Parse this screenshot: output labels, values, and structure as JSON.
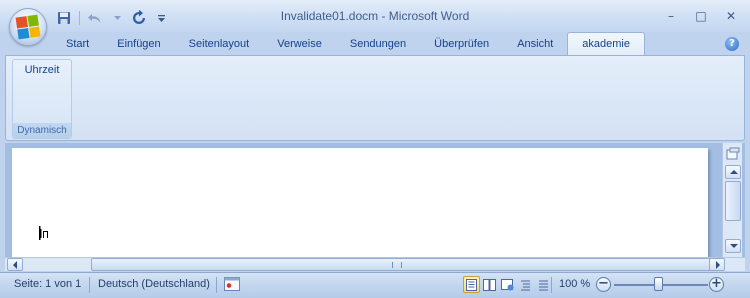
{
  "window": {
    "title": "Invalidate01.docm - Microsoft Word"
  },
  "quick_access": {
    "icons": [
      "save-icon",
      "undo-icon",
      "redo-icon",
      "customize-icon"
    ]
  },
  "window_controls": {
    "minimize": "–",
    "maximize": "□",
    "close": "✕"
  },
  "tabs": [
    {
      "label": "Start"
    },
    {
      "label": "Einfügen"
    },
    {
      "label": "Seitenlayout"
    },
    {
      "label": "Verweise"
    },
    {
      "label": "Sendungen"
    },
    {
      "label": "Überprüfen"
    },
    {
      "label": "Ansicht"
    },
    {
      "label": "akademie",
      "active": true
    }
  ],
  "help": {
    "glyph": "?"
  },
  "ribbon": {
    "group": {
      "button_label": "Uhrzeit",
      "group_label": "Dynamisch"
    }
  },
  "statusbar": {
    "page": "Seite: 1 von 1",
    "language": "Deutsch (Deutschland)",
    "zoom": "100 %",
    "zoom_minus": "−",
    "zoom_plus": "+",
    "zoom_level_percent": 100
  },
  "colors": {
    "accent": "#15428b",
    "ribbon_bg": "#dbe7f7",
    "active_view": "#ffd76b"
  }
}
